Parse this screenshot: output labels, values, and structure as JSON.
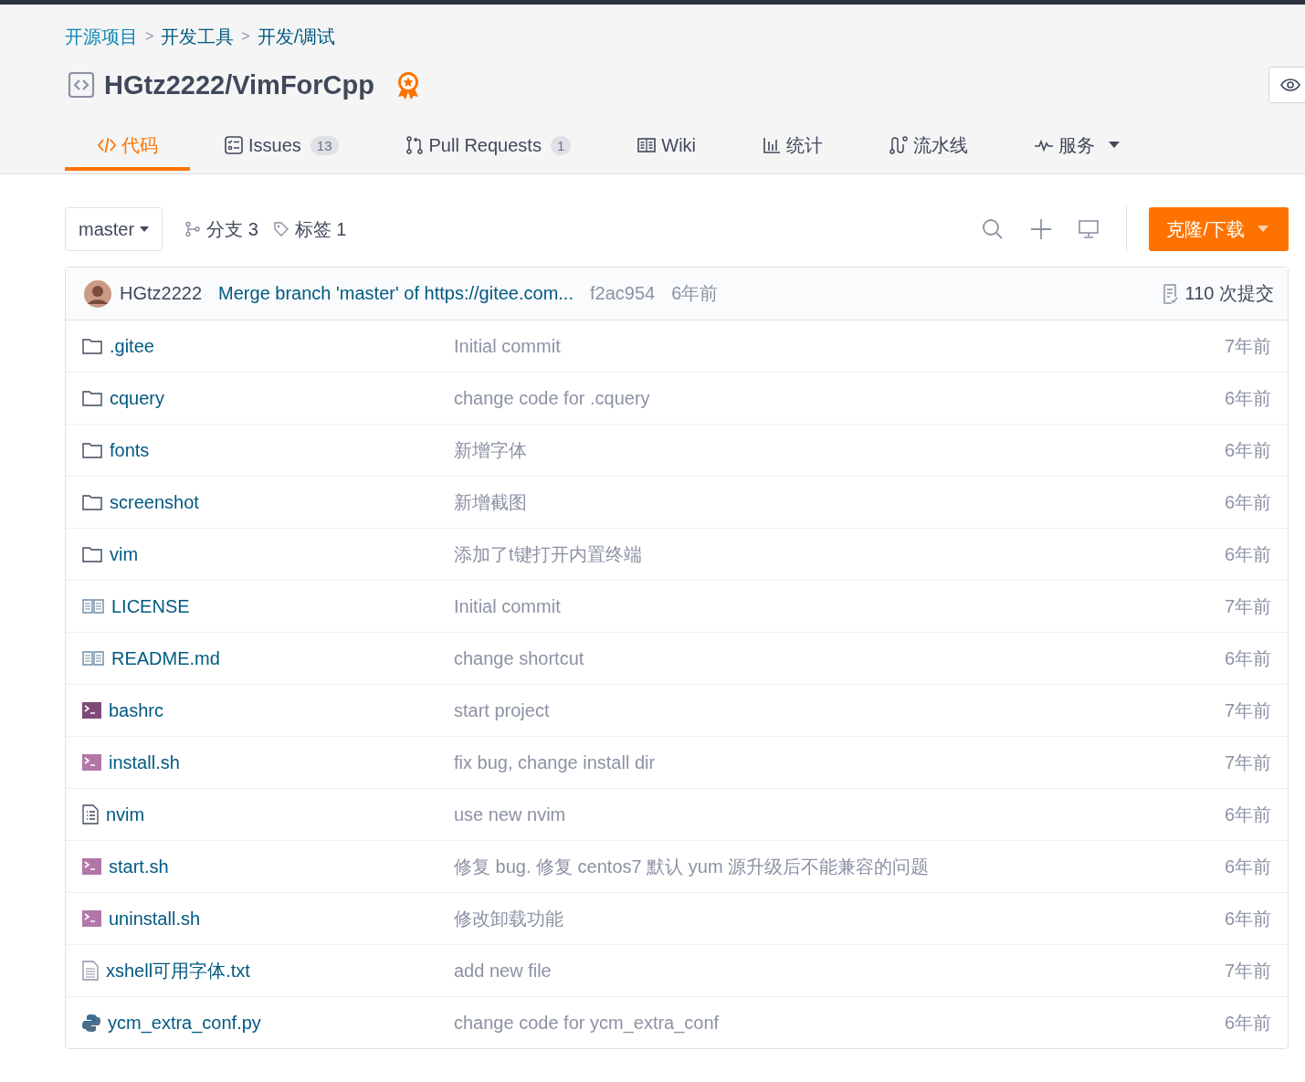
{
  "breadcrumb": [
    "开源项目",
    "开发工具",
    "开发/调试"
  ],
  "breadcrumb_separator": ">",
  "repo": {
    "title": "HGtz2222/VimForCpp",
    "recommended": true
  },
  "tabs": [
    {
      "kind": "code",
      "label": "代码",
      "selected": true
    },
    {
      "kind": "issues",
      "label": "Issues",
      "count": "13",
      "selected": false
    },
    {
      "kind": "pull",
      "label": "Pull Requests",
      "count": "1",
      "selected": false
    },
    {
      "kind": "wiki",
      "label": "Wiki",
      "selected": false
    },
    {
      "kind": "stats",
      "label": "统计",
      "selected": false
    },
    {
      "kind": "pipeline",
      "label": "流水线",
      "selected": false
    },
    {
      "kind": "service",
      "label": "服务",
      "dropdown": true,
      "selected": false
    }
  ],
  "toolbar": {
    "branch": "master",
    "branches": "分支 3",
    "tags": "标签 1",
    "clone_button": "克隆/下载"
  },
  "last_commit": {
    "author": "HGtz2222",
    "message": "Merge branch 'master' of https://gitee.com...",
    "hash": "f2ac954",
    "time": "6年前",
    "commits": "110 次提交"
  },
  "files": [
    {
      "kind": "folder",
      "name": ".gitee",
      "message": "Initial commit",
      "time": "7年前"
    },
    {
      "kind": "folder",
      "name": "cquery",
      "message": "change code for .cquery",
      "time": "6年前"
    },
    {
      "kind": "folder",
      "name": "fonts",
      "message": "新增字体",
      "time": "6年前"
    },
    {
      "kind": "folder",
      "name": "screenshot",
      "message": "新增截图",
      "time": "6年前"
    },
    {
      "kind": "folder",
      "name": "vim",
      "message": "添加了t键打开内置终端",
      "time": "6年前"
    },
    {
      "kind": "book",
      "name": "LICENSE",
      "message": "Initial commit",
      "time": "7年前"
    },
    {
      "kind": "book",
      "name": "README.md",
      "message": "change shortcut",
      "time": "6年前"
    },
    {
      "kind": "terminal",
      "name": "bashrc",
      "message": "start project",
      "time": "7年前"
    },
    {
      "kind": "script",
      "name": "install.sh",
      "message": "fix bug, change install dir",
      "time": "7年前"
    },
    {
      "kind": "list",
      "name": "nvim",
      "message": "use new nvim",
      "time": "6年前"
    },
    {
      "kind": "script",
      "name": "start.sh",
      "message": "修复 bug. 修复 centos7 默认 yum 源升级后不能兼容的问题",
      "time": "6年前"
    },
    {
      "kind": "script",
      "name": "uninstall.sh",
      "message": "修改卸载功能",
      "time": "6年前"
    },
    {
      "kind": "text",
      "name": "xshell可用字体.txt",
      "message": "add new file",
      "time": "7年前"
    },
    {
      "kind": "python",
      "name": "ycm_extra_conf.py",
      "message": "change code for ycm_extra_conf",
      "time": "6年前"
    }
  ]
}
